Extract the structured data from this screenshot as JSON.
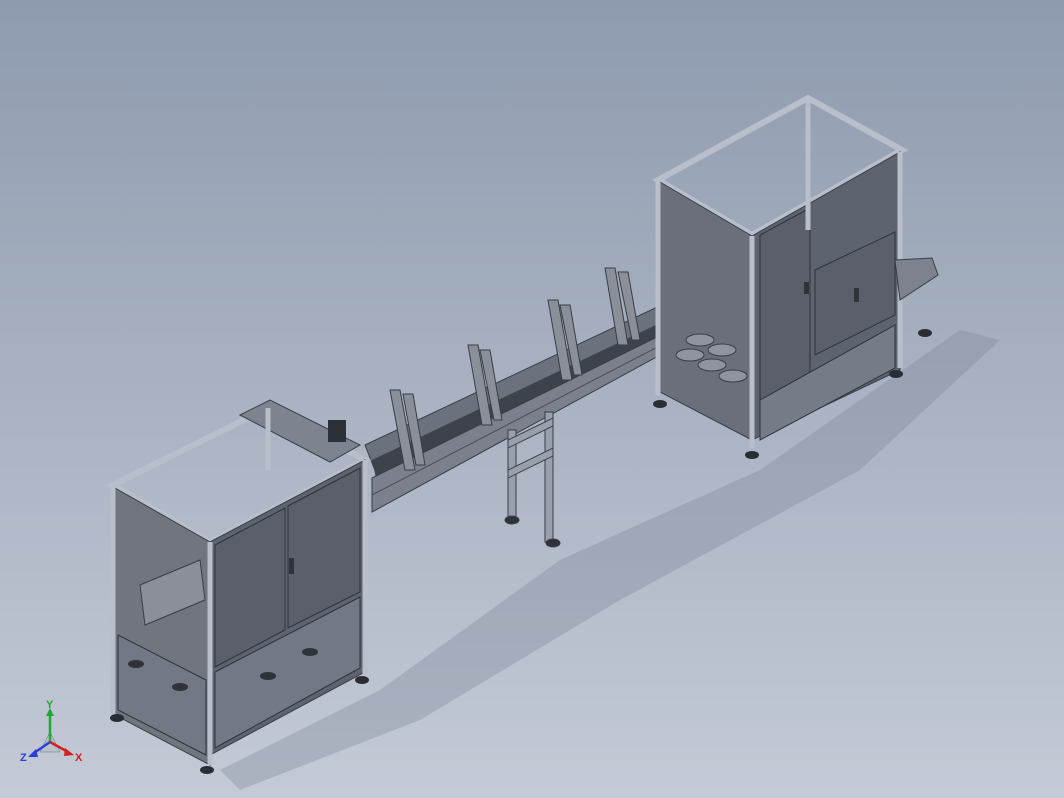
{
  "viewport": {
    "background_top": "#8e9bae",
    "background_bottom": "#c4cad6",
    "model_fill": "#5f6472",
    "frame_color": "#b9bfca"
  },
  "triad": {
    "x_label": "X",
    "y_label": "Y",
    "z_label": "Z",
    "x_color": "#d21f1f",
    "y_color": "#1fa82f",
    "z_color": "#2b3fd6"
  }
}
